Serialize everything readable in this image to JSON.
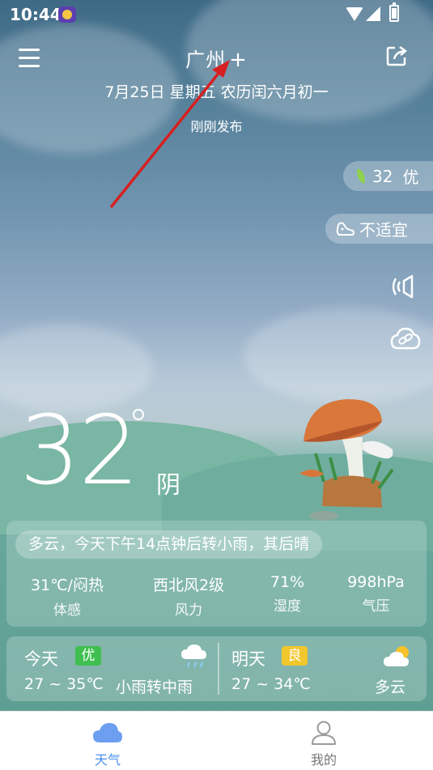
{
  "status_bar": {
    "time": "10:44"
  },
  "header": {
    "city": "广州",
    "add_symbol": "+",
    "date_line": "7月25日 星期五  农历闰六月初一",
    "publish_status": "刚刚发布"
  },
  "side_widgets": {
    "aqi_value": "32",
    "aqi_label": "优",
    "sport_label": "不适宜"
  },
  "current": {
    "temperature": "32",
    "condition": "阴"
  },
  "details": {
    "summary": "多云，今天下午14点钟后转小雨，其后晴",
    "metrics": [
      {
        "value": "31℃/闷热",
        "label": "体感"
      },
      {
        "value": "西北风2级",
        "label": "风力"
      },
      {
        "value": "71%",
        "label": "湿度"
      },
      {
        "value": "998hPa",
        "label": "气压"
      }
    ]
  },
  "forecast": {
    "today": {
      "day": "今天",
      "quality": "优",
      "range": "27 ~ 35℃",
      "condition": "小雨转中雨"
    },
    "tomorrow": {
      "day": "明天",
      "quality": "良",
      "range": "27 ~ 34℃",
      "condition": "多云"
    }
  },
  "nav": {
    "tabs": [
      {
        "label": "天气",
        "active": true
      },
      {
        "label": "我的",
        "active": false
      }
    ]
  },
  "colors": {
    "accent": "#4a90ee",
    "quality_good": "#3fbf4f",
    "quality_fair": "#f2c72e",
    "annotation_arrow": "#d62020"
  }
}
